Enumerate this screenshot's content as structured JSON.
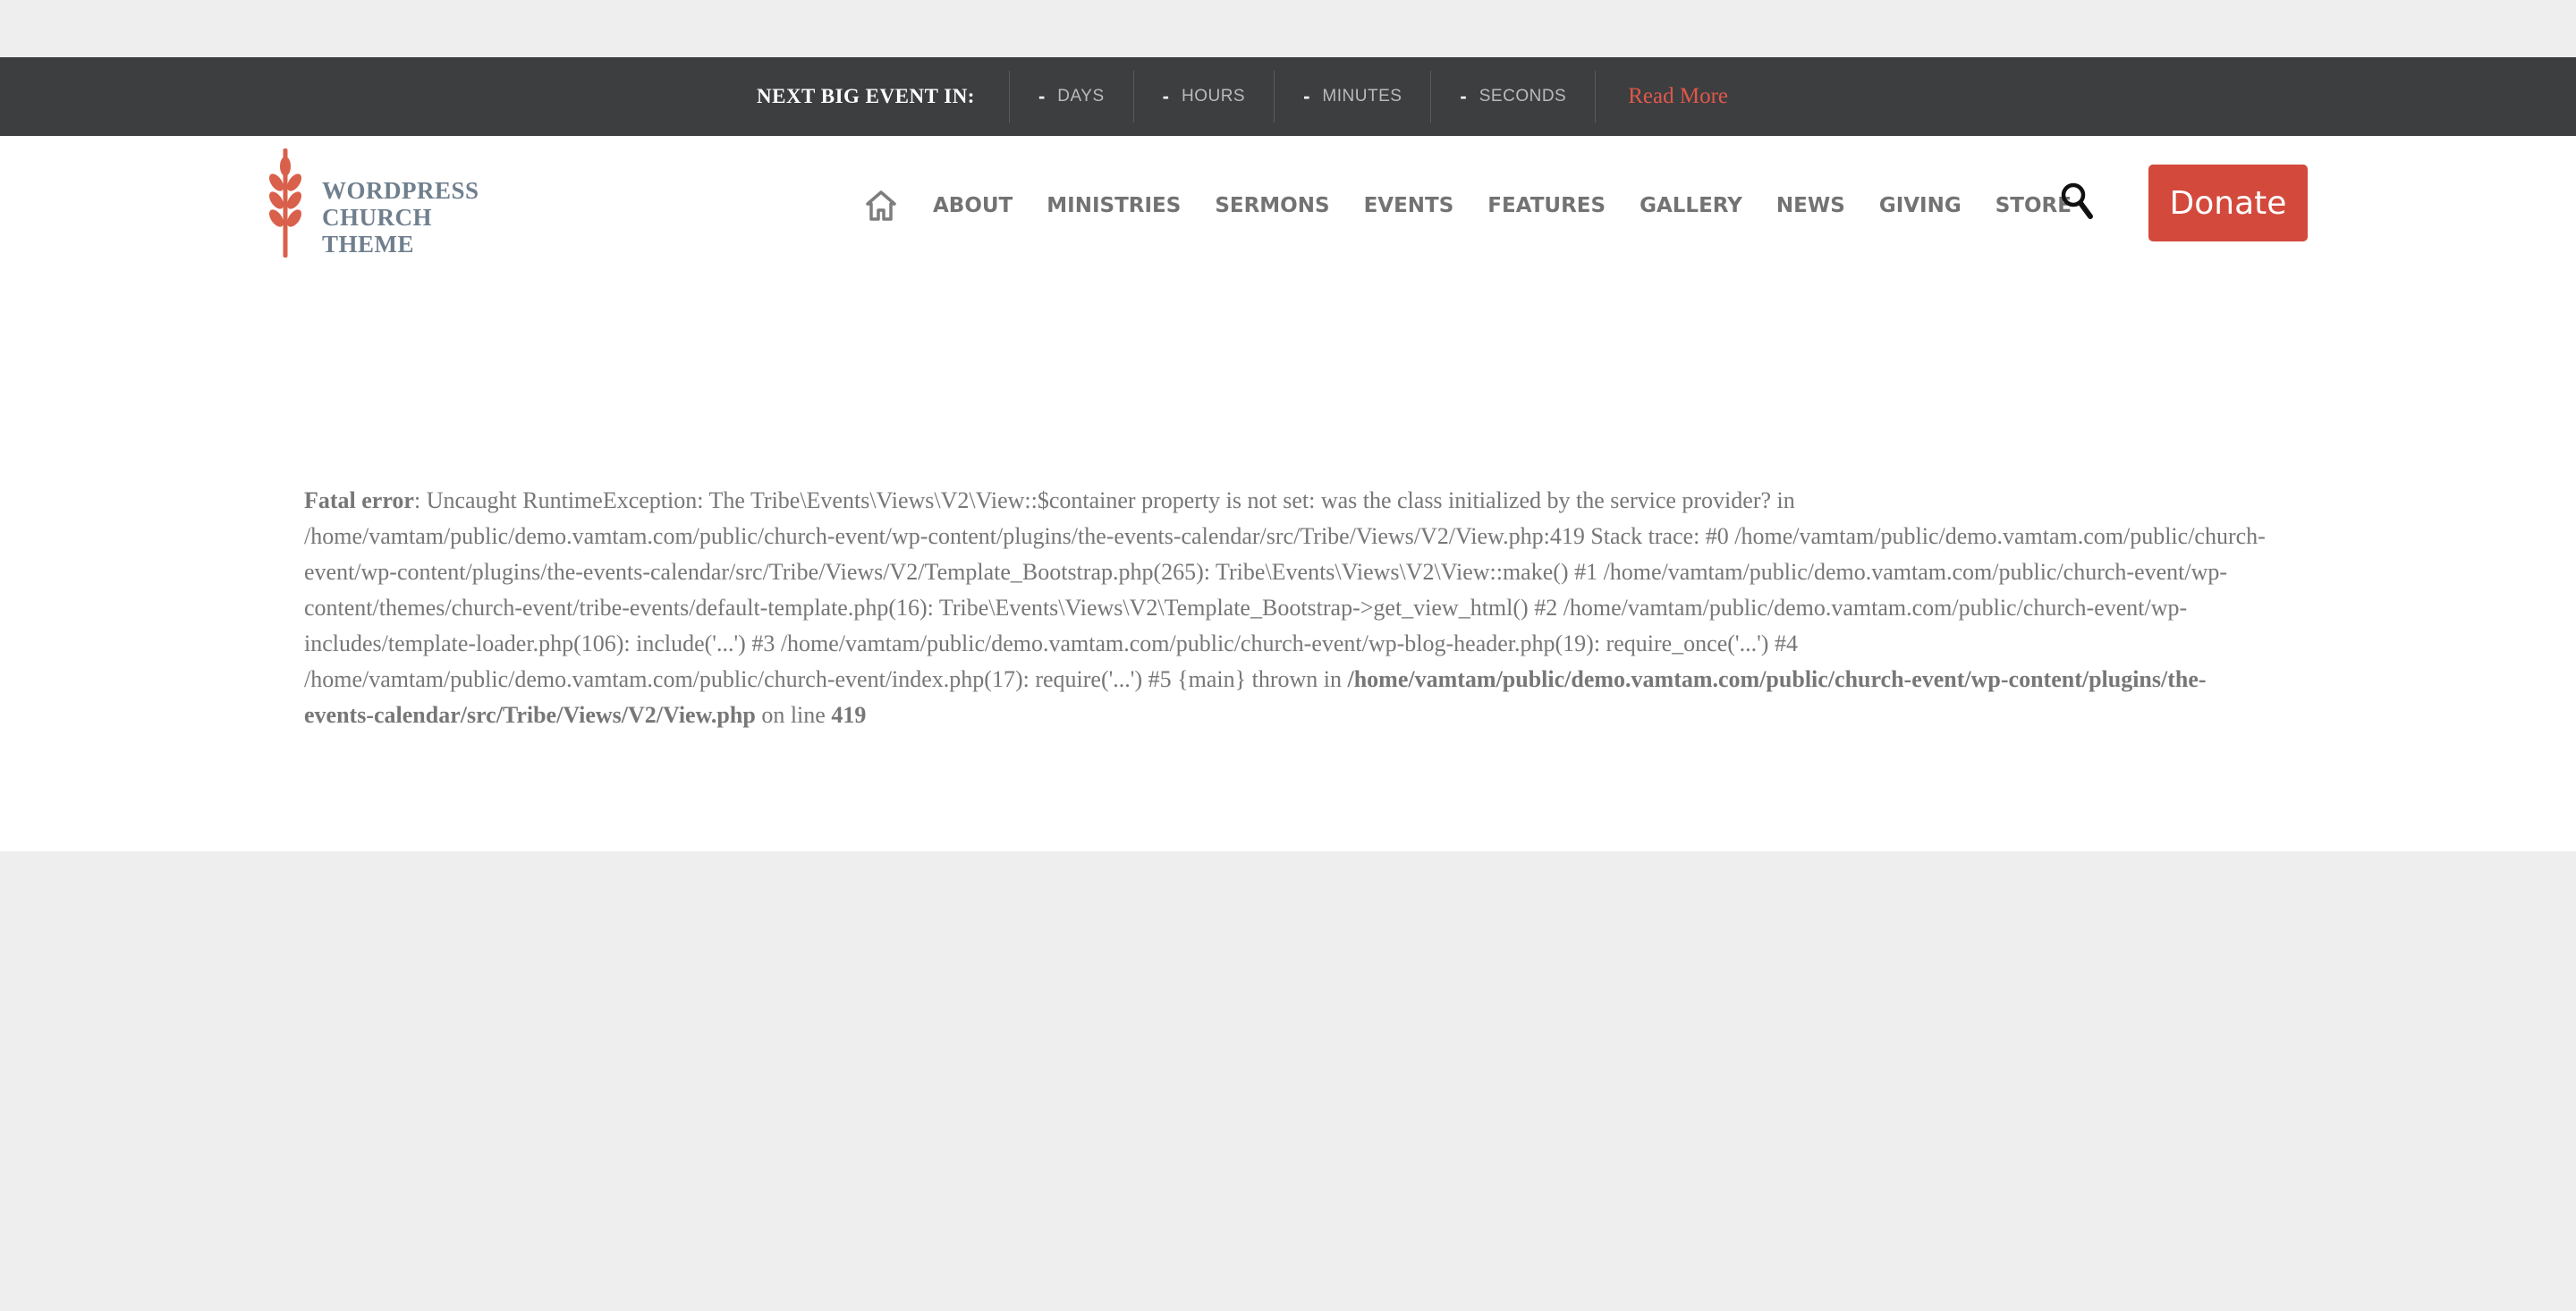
{
  "topbar": {
    "next_event_label": "NEXT BIG EVENT IN:",
    "countdown": [
      {
        "value": "-",
        "unit": "DAYS"
      },
      {
        "value": "-",
        "unit": "HOURS"
      },
      {
        "value": "-",
        "unit": "MINUTES"
      },
      {
        "value": "-",
        "unit": "SECONDS"
      }
    ],
    "read_more": "Read More"
  },
  "logo": {
    "line1": "WORDPRESS",
    "line2": "CHURCH",
    "line3": "THEME",
    "icon": "wheat-icon",
    "color": "#d9604b"
  },
  "nav": {
    "home_icon": "home-icon",
    "items": [
      "ABOUT",
      "MINISTRIES",
      "SERMONS",
      "EVENTS",
      "FEATURES",
      "GALLERY",
      "NEWS",
      "GIVING",
      "STORE"
    ],
    "search_icon": "search-icon"
  },
  "donate_label": "Donate",
  "accent_color": "#d34a3d",
  "error": {
    "label": "Fatal error",
    "message": ": Uncaught RuntimeException: The Tribe\\Events\\Views\\V2\\View::$container property is not set: was the class initialized by the service provider? in /home/vamtam/public/demo.vamtam.com/public/church-event/wp-content/plugins/the-events-calendar/src/Tribe/Views/V2/View.php:419 Stack trace: #0 /home/vamtam/public/demo.vamtam.com/public/church-event/wp-content/plugins/the-events-calendar/src/Tribe/Views/V2/Template_Bootstrap.php(265): Tribe\\Events\\Views\\V2\\View::make() #1 /home/vamtam/public/demo.vamtam.com/public/church-event/wp-content/themes/church-event/tribe-events/default-template.php(16): Tribe\\Events\\Views\\V2\\Template_Bootstrap->get_view_html() #2 /home/vamtam/public/demo.vamtam.com/public/church-event/wp-includes/template-loader.php(106): include('...') #3 /home/vamtam/public/demo.vamtam.com/public/church-event/wp-blog-header.php(19): require_once('...') #4 /home/vamtam/public/demo.vamtam.com/public/church-event/index.php(17): require('...') #5 {main} thrown in ",
    "file": "/home/vamtam/public/demo.vamtam.com/public/church-event/wp-content/plugins/the-events-calendar/src/Tribe/Views/V2/View.php",
    "on_line_text": " on line ",
    "line": "419"
  }
}
